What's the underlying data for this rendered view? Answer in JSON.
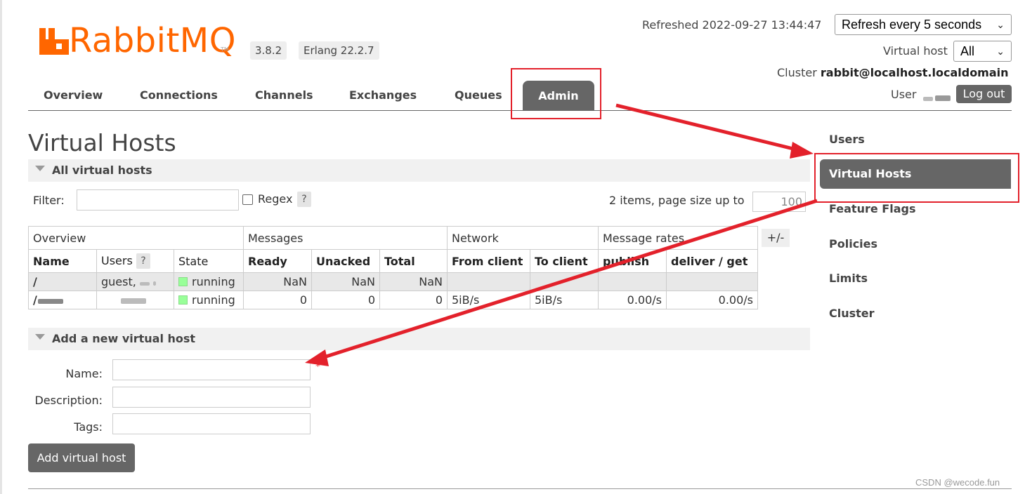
{
  "app": {
    "name": "RabbitMQ",
    "version": "3.8.2",
    "erlang": "Erlang 22.2.7"
  },
  "status": {
    "refreshed_label": "Refreshed 2022-09-27 13:44:47",
    "refresh_select": "Refresh every 5 seconds",
    "vhost_label": "Virtual host",
    "vhost_select": "All",
    "cluster_label": "Cluster",
    "cluster_name": "rabbit@localhost.localdomain",
    "user_label": "User",
    "logout": "Log out"
  },
  "nav": {
    "overview": "Overview",
    "connections": "Connections",
    "channels": "Channels",
    "exchanges": "Exchanges",
    "queues": "Queues",
    "admin": "Admin"
  },
  "page": {
    "title": "Virtual Hosts",
    "section_all": "All virtual hosts",
    "filter_label": "Filter:",
    "regex_label": "Regex",
    "help": "?",
    "items_label": "2 items, page size up to",
    "page_size": "100",
    "columns_toggle": "+/-"
  },
  "table": {
    "groups": [
      "Overview",
      "Messages",
      "Network",
      "Message rates"
    ],
    "headers": {
      "name": "Name",
      "users": "Users",
      "state": "State",
      "ready": "Ready",
      "unacked": "Unacked",
      "total": "Total",
      "from_client": "From client",
      "to_client": "To client",
      "publish": "publish",
      "deliver_get": "deliver / get"
    },
    "rows": [
      {
        "name": "/",
        "users": "guest,",
        "state": "running",
        "ready": "NaN",
        "unacked": "NaN",
        "total": "NaN",
        "from_client": "",
        "to_client": "",
        "publish": "",
        "deliver_get": ""
      },
      {
        "name": "/",
        "users": "",
        "state": "running",
        "ready": "0",
        "unacked": "0",
        "total": "0",
        "from_client": "5iB/s",
        "to_client": "5iB/s",
        "publish": "0.00/s",
        "deliver_get": "0.00/s"
      }
    ]
  },
  "form": {
    "section_add": "Add a new virtual host",
    "name_label": "Name:",
    "description_label": "Description:",
    "tags_label": "Tags:",
    "required_mark": "*",
    "submit": "Add virtual host"
  },
  "sidebar": {
    "items": [
      "Users",
      "Virtual Hosts",
      "Feature Flags",
      "Policies",
      "Limits",
      "Cluster"
    ]
  },
  "watermark": "CSDN @wecode.fun",
  "colors": {
    "brand": "#ff6600",
    "tab_active": "#666666",
    "annotation": "#e3212b",
    "running": "#99ff99"
  }
}
